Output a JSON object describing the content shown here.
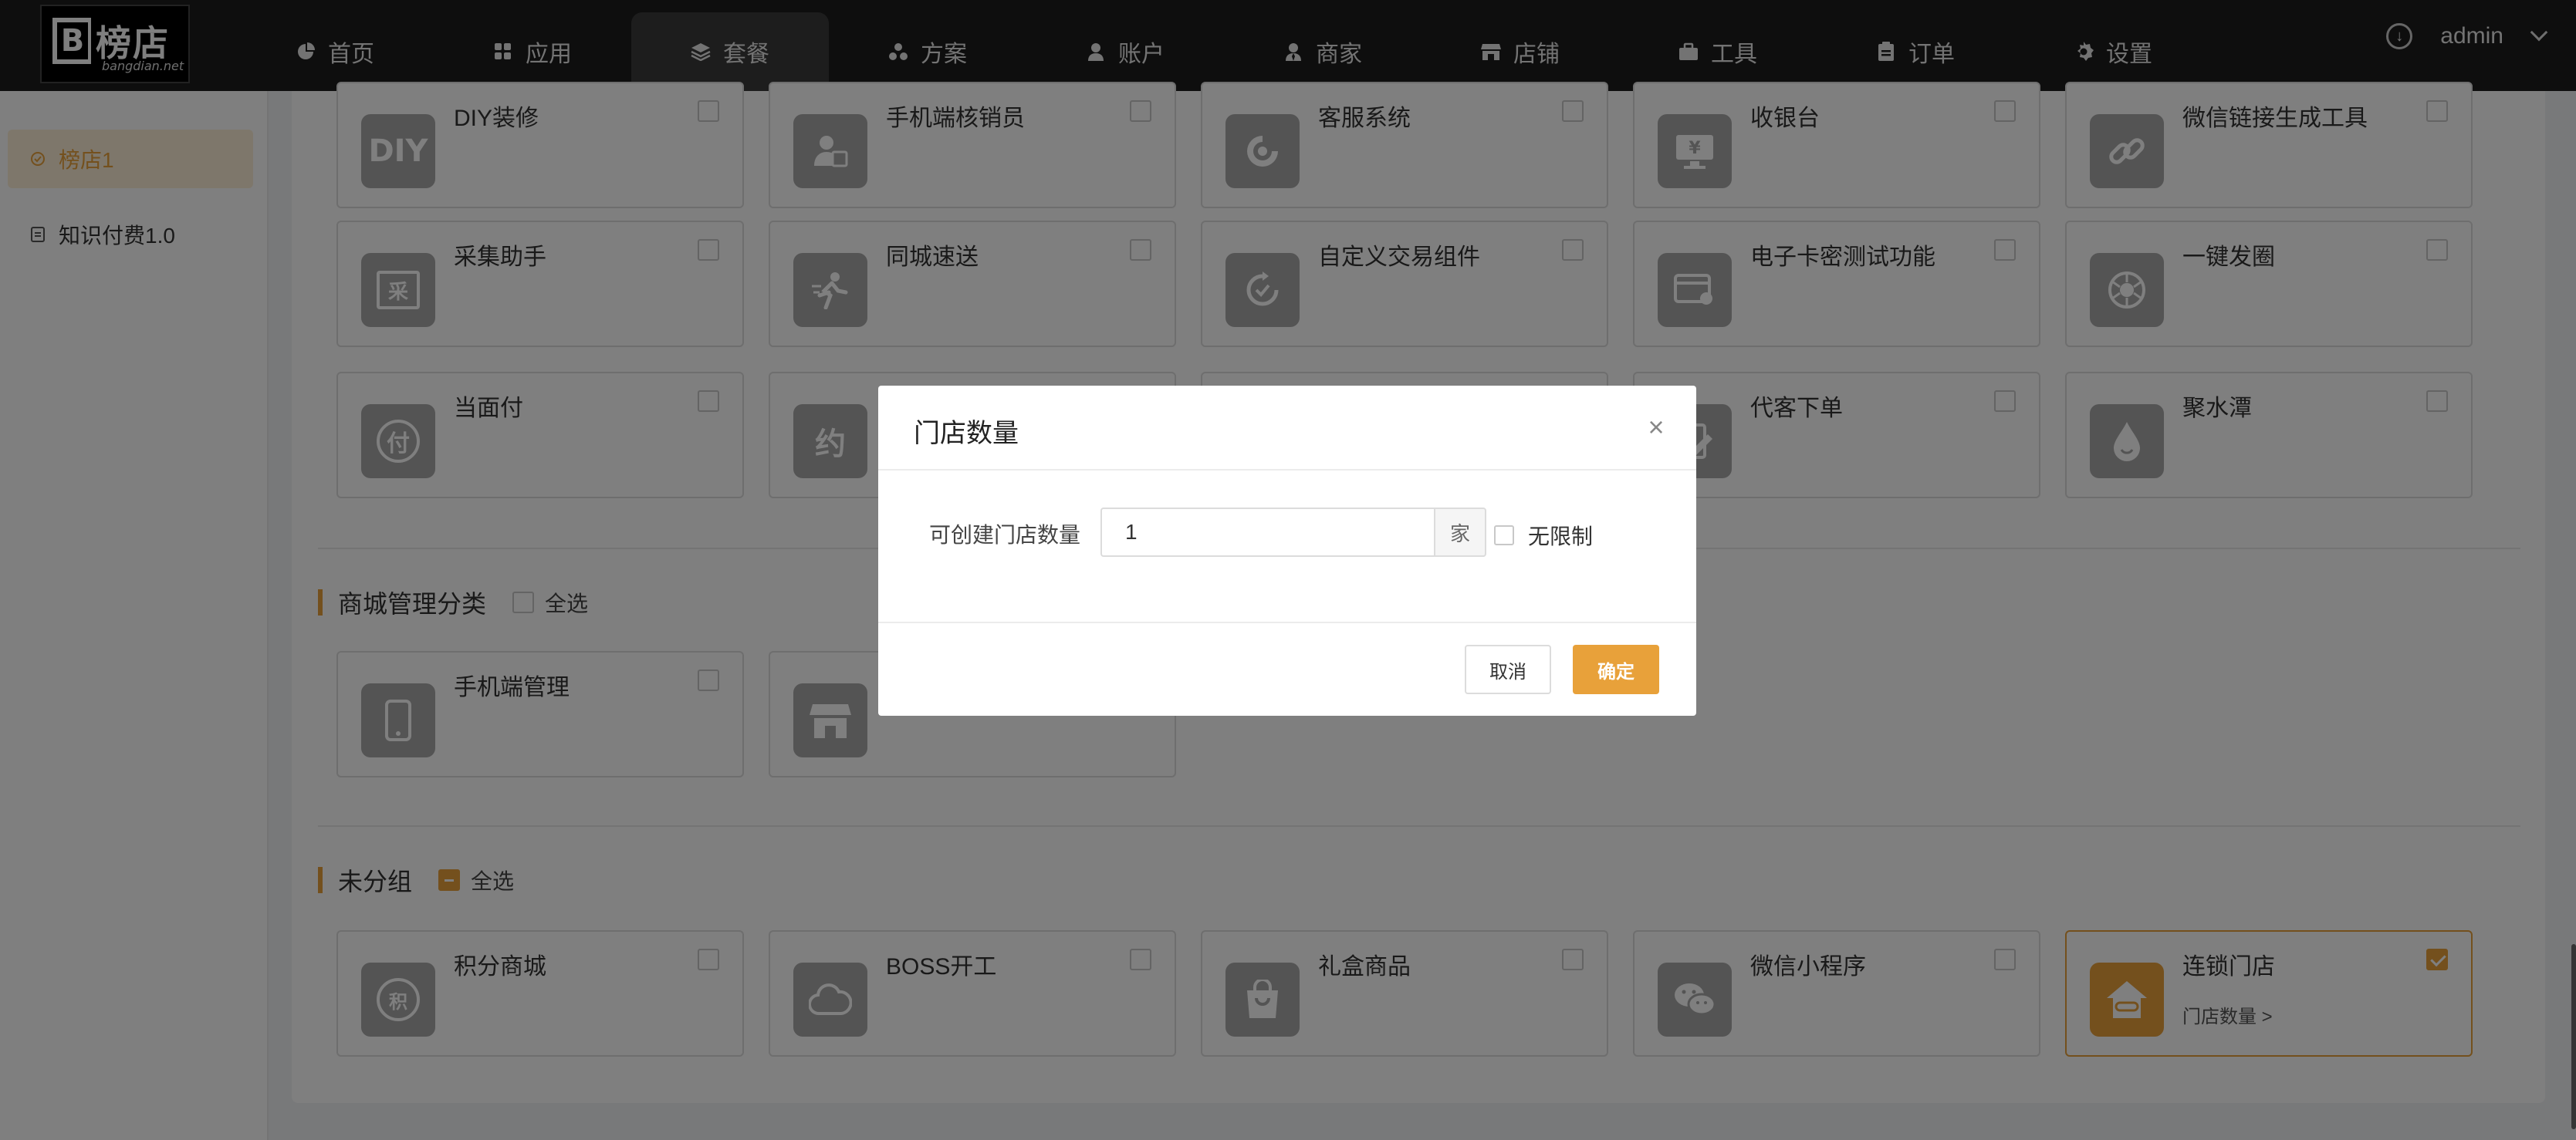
{
  "brand": {
    "logo_mark": "B",
    "logo_text": "榜店",
    "logo_sub": "bangdian.net"
  },
  "nav": [
    {
      "label": "首页",
      "icon": "pie-chart-icon"
    },
    {
      "label": "应用",
      "icon": "grid-icon"
    },
    {
      "label": "套餐",
      "icon": "layers-icon",
      "active": true
    },
    {
      "label": "方案",
      "icon": "cluster-icon"
    },
    {
      "label": "账户",
      "icon": "user-icon"
    },
    {
      "label": "商家",
      "icon": "merchant-icon"
    },
    {
      "label": "店铺",
      "icon": "store-icon"
    },
    {
      "label": "工具",
      "icon": "toolbox-icon"
    },
    {
      "label": "订单",
      "icon": "clipboard-icon"
    },
    {
      "label": "设置",
      "icon": "gear-icon"
    }
  ],
  "user": {
    "name": "admin",
    "download_icon": "download-icon"
  },
  "sidebar": {
    "items": [
      {
        "label": "榜店1",
        "active": true,
        "icon": "circle-check-icon"
      },
      {
        "label": "知识付费1.0",
        "icon": "document-icon"
      }
    ]
  },
  "grid_top": [
    {
      "name": "DIY装修",
      "icon_text": "DIY"
    },
    {
      "name": "手机端核销员",
      "icon_text": ""
    },
    {
      "name": "客服系统",
      "icon_text": ""
    },
    {
      "name": "收银台",
      "icon_text": "¥"
    },
    {
      "name": "微信链接生成工具",
      "icon_text": ""
    },
    {
      "name": "采集助手",
      "icon_text": "采"
    },
    {
      "name": "同城速送",
      "icon_text": ""
    },
    {
      "name": "自定义交易组件",
      "icon_text": ""
    },
    {
      "name": "电子卡密测试功能",
      "icon_text": ""
    },
    {
      "name": "一键发圈",
      "icon_text": ""
    },
    {
      "name": "当面付",
      "icon_text": "付"
    },
    {
      "name": "",
      "icon_text": "约"
    },
    {
      "name": "代客下单",
      "icon_text": ""
    },
    {
      "name": "聚水潭",
      "icon_text": ""
    }
  ],
  "section_mall": {
    "title": "商城管理分类",
    "select_all": "全选"
  },
  "mall_cards": [
    {
      "name": "手机端管理",
      "icon_text": ""
    },
    {
      "name": "",
      "icon_text": ""
    }
  ],
  "section_ungrouped": {
    "title": "未分组",
    "select_all": "全选"
  },
  "ungrouped_cards": [
    {
      "name": "积分商城",
      "icon_text": "积"
    },
    {
      "name": "BOSS开工",
      "icon_text": ""
    },
    {
      "name": "礼盒商品",
      "icon_text": ""
    },
    {
      "name": "微信小程序",
      "icon_text": ""
    },
    {
      "name": "连锁门店",
      "icon_text": "",
      "sub": "门店数量 >",
      "checked": true
    }
  ],
  "modal": {
    "title": "门店数量",
    "field_label": "可创建门店数量",
    "field_value": "1",
    "field_suffix": "家",
    "unlimited_label": "无限制",
    "cancel_label": "取消",
    "ok_label": "确定"
  },
  "colors": {
    "accent": "#e8a13a",
    "topbar": "#1c1c1c",
    "overlay": "rgba(0,0,0,0.5)"
  }
}
